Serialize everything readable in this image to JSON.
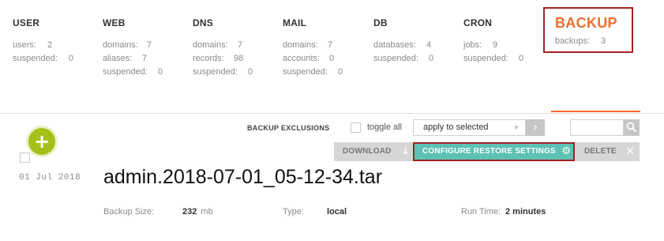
{
  "stats": {
    "user": {
      "title": "USER",
      "rows": [
        {
          "label": "users:",
          "value": "2"
        },
        {
          "label": "suspended:",
          "value": "0"
        }
      ]
    },
    "web": {
      "title": "WEB",
      "rows": [
        {
          "label": "domains:",
          "value": "7"
        },
        {
          "label": "aliases:",
          "value": "7"
        },
        {
          "label": "suspended:",
          "value": "0"
        }
      ]
    },
    "dns": {
      "title": "DNS",
      "rows": [
        {
          "label": "domains:",
          "value": "7"
        },
        {
          "label": "records:",
          "value": "98"
        },
        {
          "label": "suspended:",
          "value": "0"
        }
      ]
    },
    "mail": {
      "title": "MAIL",
      "rows": [
        {
          "label": "domains:",
          "value": "7"
        },
        {
          "label": "accounts:",
          "value": "0"
        },
        {
          "label": "suspended:",
          "value": "0"
        }
      ]
    },
    "db": {
      "title": "DB",
      "rows": [
        {
          "label": "databases:",
          "value": "4"
        },
        {
          "label": "suspended:",
          "value": "0"
        }
      ]
    },
    "cron": {
      "title": "CRON",
      "rows": [
        {
          "label": "jobs:",
          "value": "9"
        },
        {
          "label": "suspended:",
          "value": "0"
        }
      ]
    },
    "backup": {
      "title": "BACKUP",
      "rows": [
        {
          "label": "backups:",
          "value": "3"
        }
      ]
    }
  },
  "toolbar": {
    "exclusions_label": "BACKUP EXCLUSIONS",
    "toggle_all_label": "toggle all",
    "bulk_select_value": "apply to selected",
    "search_value": ""
  },
  "actions": {
    "download": "DOWNLOAD",
    "configure": "CONFIGURE RESTORE SETTINGS",
    "delete": "DELETE"
  },
  "backup_item": {
    "date": "01 Jul 2018",
    "filename": "admin.2018-07-01_05-12-34.tar",
    "size_label": "Backup Size:",
    "size_value": "232",
    "size_unit": "mb",
    "type_label": "Type:",
    "type_value": "local",
    "runtime_label": "Run Time:",
    "runtime_value": "2 minutes"
  },
  "colors": {
    "accent_orange": "#ef6e2f",
    "highlight_red": "#a32222",
    "teal": "#5dc1b5",
    "add_green": "#a4c11b"
  }
}
